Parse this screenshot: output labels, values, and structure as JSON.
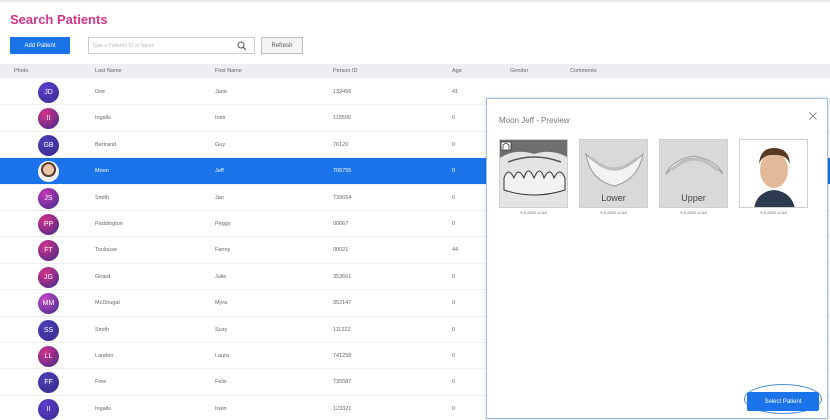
{
  "page": {
    "title": "Search Patients"
  },
  "toolbar": {
    "add_label": "Add Patient",
    "search_placeholder": "Type a Patient's ID or Name",
    "refresh_label": "Refresh"
  },
  "table": {
    "headers": {
      "photo": "Photo",
      "last": "Last Name",
      "first": "First Name",
      "pid": "Person ID",
      "age": "Age",
      "gender": "Gender",
      "comments": "Comments"
    },
    "rows": [
      {
        "initials": "JD",
        "last": "Doe",
        "first": "Jane",
        "pid": "132456",
        "age": "41",
        "color": "#5a3fd0",
        "selected": false,
        "photo": false
      },
      {
        "initials": "II",
        "last": "Ingalls",
        "first": "Inés",
        "pid": "115599",
        "age": "0",
        "color": "#d6338a",
        "selected": false,
        "photo": false
      },
      {
        "initials": "GB",
        "last": "Bertrand",
        "first": "Guy",
        "pid": "76120",
        "age": "0",
        "color": "#4a3fb5",
        "selected": false,
        "photo": false
      },
      {
        "initials": "",
        "last": "Moon",
        "first": "Jeff",
        "pid": "706755",
        "age": "0",
        "color": "#ffffff",
        "selected": true,
        "photo": true
      },
      {
        "initials": "JS",
        "last": "Smith",
        "first": "Jan",
        "pid": "739654",
        "age": "0",
        "color": "#c238b8",
        "selected": false,
        "photo": false
      },
      {
        "initials": "PP",
        "last": "Paddington",
        "first": "Peggy",
        "pid": "00667",
        "age": "0",
        "color": "#d6338a",
        "selected": false,
        "photo": false
      },
      {
        "initials": "FT",
        "last": "Toulouse",
        "first": "Fanny",
        "pid": "00021",
        "age": "44",
        "color": "#d6338a",
        "selected": false,
        "photo": false
      },
      {
        "initials": "JG",
        "last": "Girard",
        "first": "Julie",
        "pid": "353661",
        "age": "0",
        "color": "#d6338a",
        "selected": false,
        "photo": false
      },
      {
        "initials": "MM",
        "last": "McDougal",
        "first": "Myra",
        "pid": "352147",
        "age": "0",
        "color": "#c94ac6",
        "selected": false,
        "photo": false
      },
      {
        "initials": "SS",
        "last": "Smith",
        "first": "Suzy",
        "pid": "111222",
        "age": "0",
        "color": "#4a3fb5",
        "selected": false,
        "photo": false
      },
      {
        "initials": "LL",
        "last": "Landon",
        "first": "Laura",
        "pid": "741258",
        "age": "0",
        "color": "#d6338a",
        "selected": false,
        "photo": false
      },
      {
        "initials": "FF",
        "last": "Free",
        "first": "Felix",
        "pid": "735587",
        "age": "0",
        "color": "#4a3fb5",
        "selected": false,
        "photo": false
      },
      {
        "initials": "II",
        "last": "Ingalls",
        "first": "Irwin",
        "pid": "123321",
        "age": "0",
        "color": "#5a3fd0",
        "selected": false,
        "photo": false
      }
    ]
  },
  "preview": {
    "title": "Moon Jeff - Preview",
    "thumbs": [
      {
        "label": "",
        "date": "9.9.2020 11:46",
        "kind": "scan"
      },
      {
        "label": "Lower",
        "date": "9.9.2020 11:46",
        "kind": "lower"
      },
      {
        "label": "Upper",
        "date": "9.9.2020 11:46",
        "kind": "upper"
      },
      {
        "label": "",
        "date": "9.9.2020 11:46",
        "kind": "photo"
      }
    ],
    "select_label": "Select Patient"
  },
  "colors": {
    "accent": "#1a73e8",
    "title": "#d6338a",
    "header_bg": "#ededf2"
  }
}
